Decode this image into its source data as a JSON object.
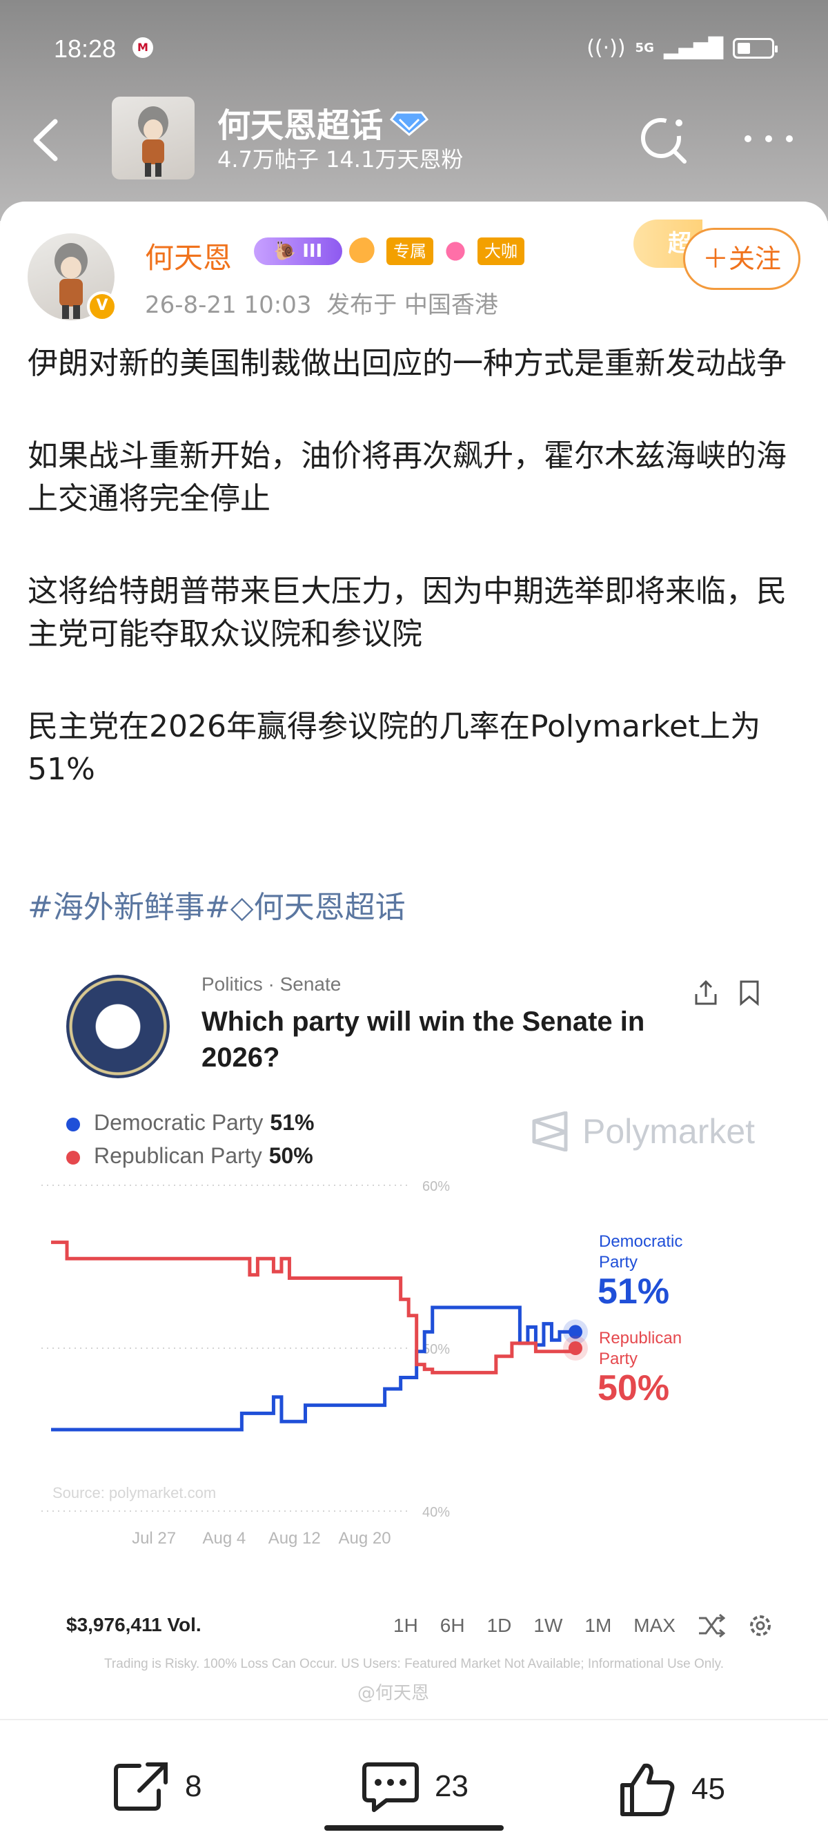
{
  "status_bar": {
    "time": "18:28",
    "network": "5G",
    "carrier_icon": "carrier-logo-icon"
  },
  "top_bar": {
    "title": "何天恩超话",
    "subtitle": "4.7万帖子 14.1万天恩粉",
    "icons": [
      "back-arrow-icon",
      "diamond-verified-icon",
      "search-refresh-icon",
      "more-dots-icon"
    ]
  },
  "post": {
    "author": "何天恩",
    "level_badge": "III",
    "tag_exclusive": "专属",
    "tag_bigcoffee": "大咖",
    "super_badge": "超",
    "verified_mark": "V",
    "timestamp": "26-8-21 10:03",
    "location": "发布于 中国香港",
    "follow_label": "＋关注",
    "paragraphs": [
      "伊朗对新的美国制裁做出回应的一种方式是重新发动战争",
      "如果战斗重新开始，油价将再次飙升，霍尔木兹海峡的海上交通将完全停止",
      "这将给特朗普带来巨大压力，因为中期选举即将来临，民主党可能夺取众议院和参议院",
      "民主党在2026年赢得参议院的几率在Polymarket上为51%"
    ],
    "hashtags": "#海外新鲜事#◇何天恩超话"
  },
  "embedded": {
    "category": "Politics · Senate",
    "question": "Which party will win the Senate in 2026?",
    "brand": "Polymarket",
    "volume": "$3,976,411 Vol.",
    "ranges": [
      "1H",
      "6H",
      "1D",
      "1W",
      "1M",
      "MAX"
    ],
    "disclaimer": "Trading is Risky. 100% Loss Can Occur. US Users: Featured Market Not Available; Informational Use Only.",
    "watermark": "@何天恩",
    "source_note": "Source: polymarket.com",
    "colors": {
      "dem": "#1f4fd8",
      "rep": "#e5484d"
    }
  },
  "chart_data": {
    "type": "line",
    "ylim": [
      40,
      60
    ],
    "yticks": [
      "60%",
      "50%",
      "40%"
    ],
    "xticks": [
      "Jul 27",
      "Aug 4",
      "Aug 12",
      "Aug 20"
    ],
    "series": [
      {
        "name": "Democratic Party",
        "legend_value": "51%",
        "end_label": "Democratic Party",
        "end_value": "51%",
        "x": [
          "Jul 20",
          "Jul 28",
          "Aug 1",
          "Aug 2",
          "Aug 3",
          "Aug 3.5",
          "Aug 5",
          "Aug 8",
          "Aug 10",
          "Aug 11",
          "Aug 12",
          "Aug 12.5",
          "Aug 13",
          "Aug 18",
          "Aug 18.5",
          "Aug 19",
          "Aug 19.5",
          "Aug 20",
          "Aug 20.5",
          "Aug 21",
          "Aug 22"
        ],
        "values": [
          45,
          45,
          46,
          46,
          47,
          45.5,
          46.5,
          46.5,
          47.5,
          48.2,
          49.8,
          51,
          52.5,
          52.5,
          50.3,
          51.3,
          50.2,
          51.5,
          50.5,
          51,
          51
        ]
      },
      {
        "name": "Republican Party",
        "legend_value": "50%",
        "end_label": "Republican Party",
        "end_value": "50%",
        "x": [
          "Jul 20",
          "Jul 21",
          "Aug 1",
          "Aug 1.5",
          "Aug 2",
          "Aug 3",
          "Aug 3.5",
          "Aug 4",
          "Aug 10",
          "Aug 11",
          "Aug 11.5",
          "Aug 12",
          "Aug 12.5",
          "Aug 13",
          "Aug 16",
          "Aug 17",
          "Aug 18",
          "Aug 19",
          "Aug 19.5",
          "Aug 22"
        ],
        "values": [
          56.5,
          55.5,
          55.5,
          54.5,
          55.5,
          54.7,
          55.5,
          54.3,
          54.3,
          53,
          52,
          49,
          48.7,
          48.5,
          48.5,
          49.5,
          50.3,
          50.3,
          49.8,
          50
        ]
      }
    ]
  },
  "actions": {
    "share_count": "8",
    "comment_count": "23",
    "like_count": "45"
  }
}
